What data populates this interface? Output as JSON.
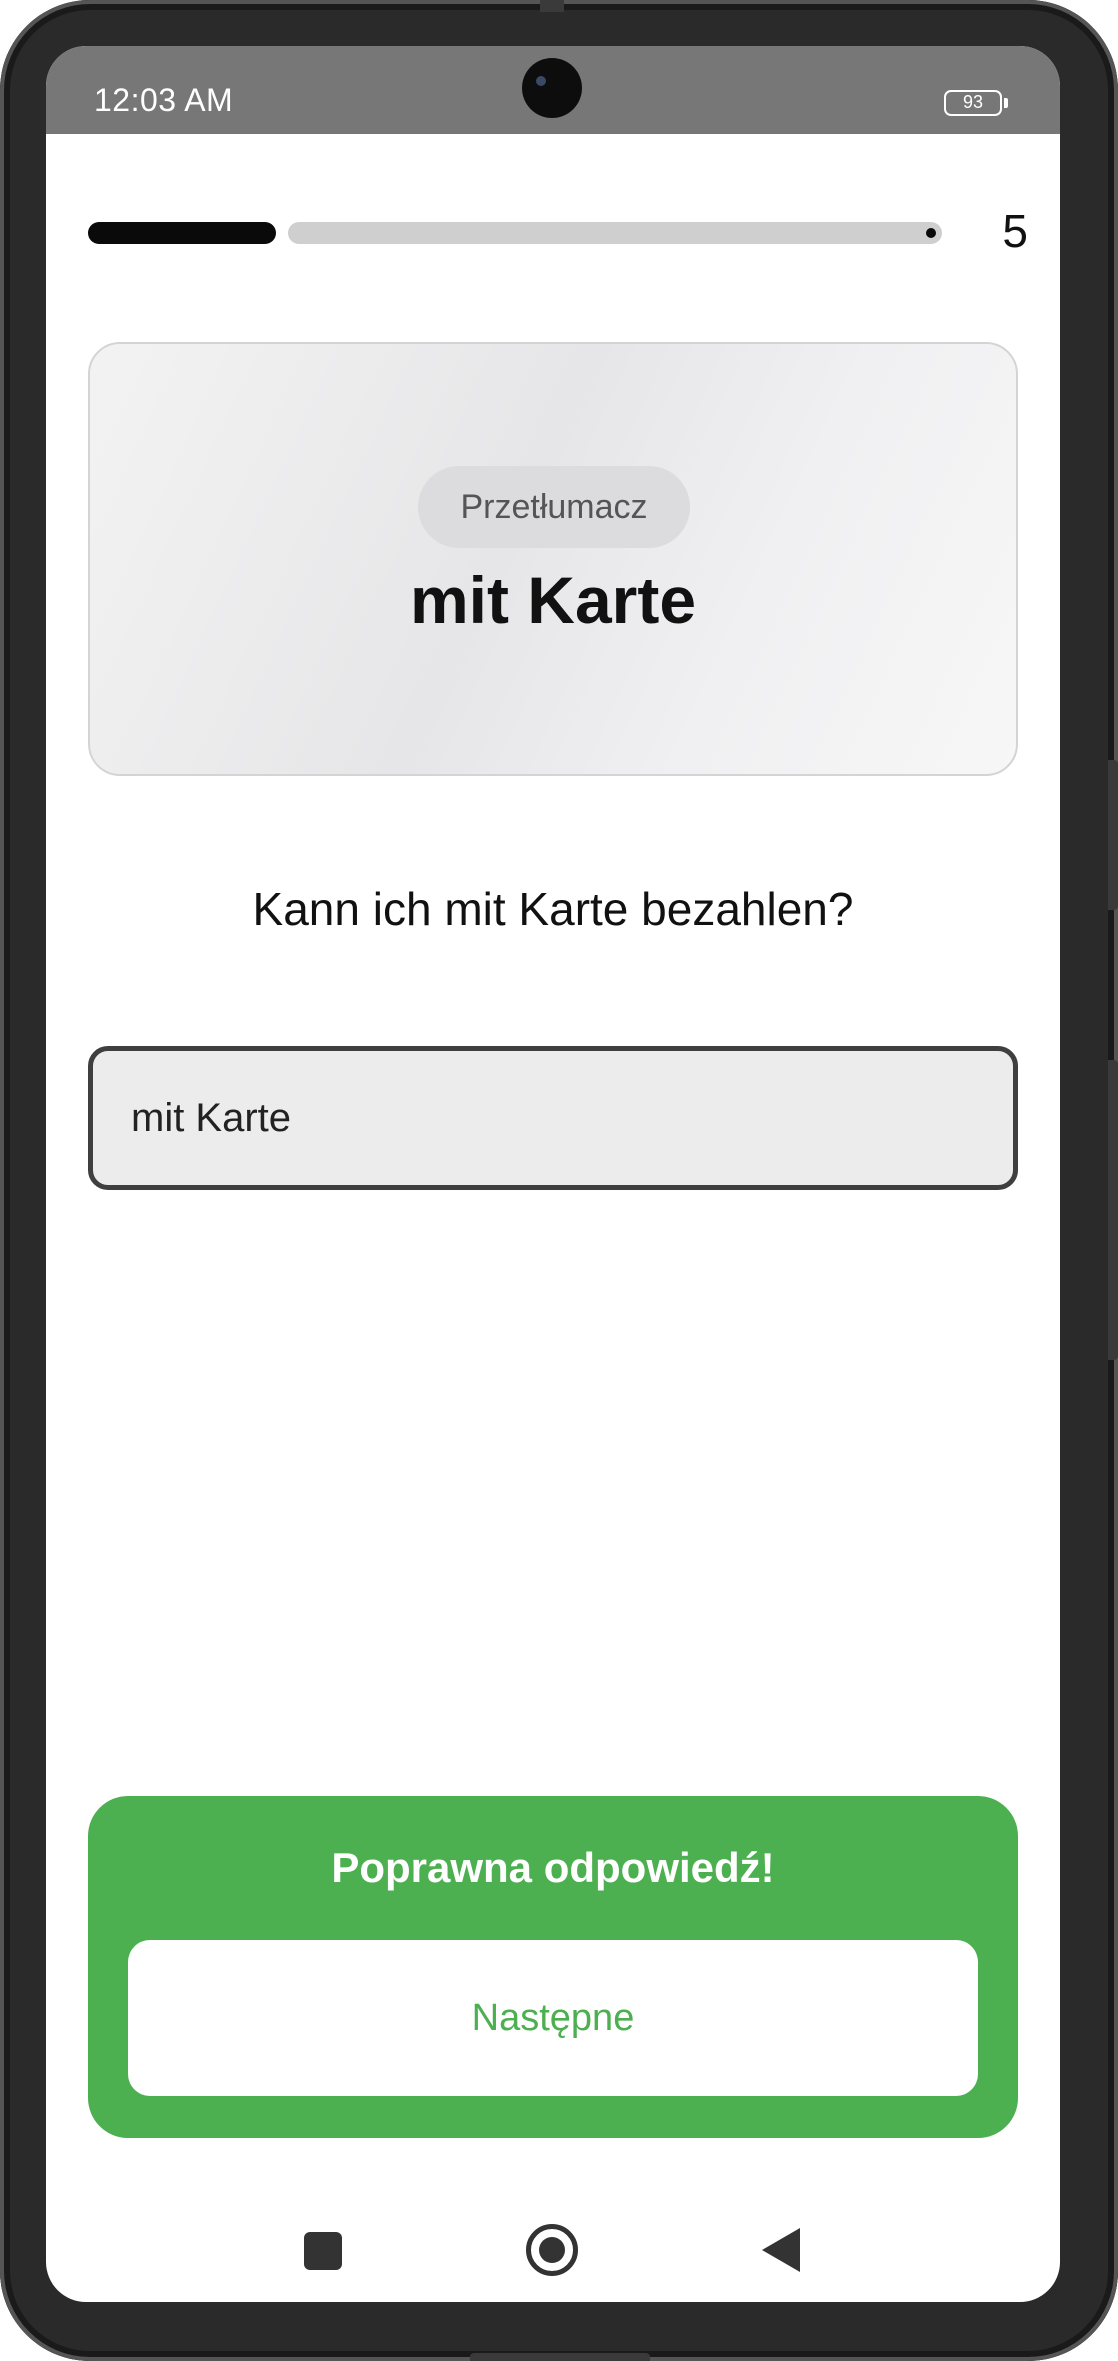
{
  "status_bar": {
    "time": "12:03 AM",
    "battery": "93"
  },
  "progress": {
    "completed_fraction": 0.22,
    "count": "5"
  },
  "card": {
    "chip_label": "Przetłumacz",
    "word": "mit Karte"
  },
  "sentence": "Kann ich mit Karte bezahlen?",
  "answer": {
    "value": "mit Karte"
  },
  "result": {
    "message": "Poprawna odpowiedź!",
    "next_label": "Następne"
  },
  "colors": {
    "success": "#4caf50",
    "progress_fill": "#0a0a0a",
    "progress_track": "#cfcfcf"
  },
  "icons": {
    "nav_recent": "square-icon",
    "nav_home": "circle-icon",
    "nav_back": "triangle-back-icon"
  }
}
